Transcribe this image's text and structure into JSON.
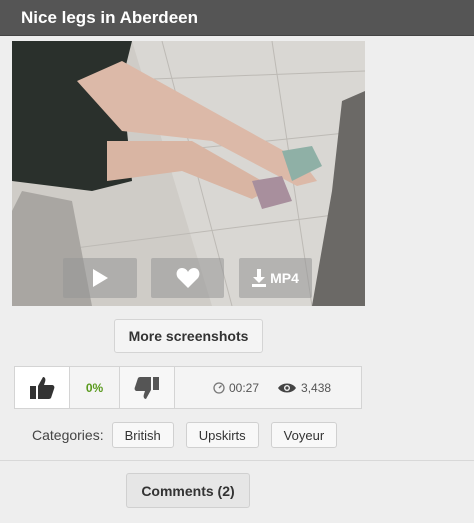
{
  "header": {
    "title": "Nice legs in Aberdeen"
  },
  "player": {
    "icons": [
      "play-icon",
      "heart-icon",
      "download-icon"
    ],
    "download_label": "MP4"
  },
  "more_screenshots_label": "More screenshots",
  "rating": {
    "percent": "0%",
    "duration": "00:27",
    "views": "3,438",
    "colors": {
      "percent": "#5a9a1e"
    }
  },
  "categories": {
    "label": "Categories:",
    "items": [
      "British",
      "Upskirts",
      "Voyeur"
    ]
  },
  "comments_label": "Comments (2)"
}
